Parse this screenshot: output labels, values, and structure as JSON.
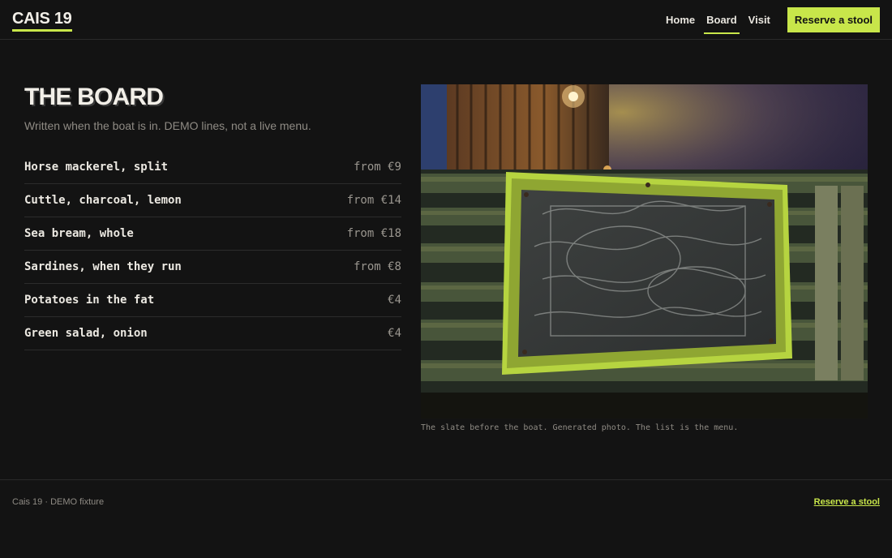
{
  "header": {
    "logo": "CAIS 19",
    "nav": [
      {
        "label": "Home",
        "active": false
      },
      {
        "label": "Board",
        "active": true
      },
      {
        "label": "Visit",
        "active": false
      }
    ],
    "cta_label": "Reserve a stool"
  },
  "board": {
    "title": "THE BOARD",
    "subtitle": "Written when the boat is in. DEMO lines, not a live menu.",
    "items": [
      {
        "name": "Horse mackerel, split",
        "price": "from €9"
      },
      {
        "name": "Cuttle, charcoal, lemon",
        "price": "from €14"
      },
      {
        "name": "Sea bream, whole",
        "price": "from €18"
      },
      {
        "name": "Sardines, when they run",
        "price": "from €8"
      },
      {
        "name": "Potatoes in the fat",
        "price": "€4"
      },
      {
        "name": "Green salad, onion",
        "price": "€4"
      }
    ]
  },
  "photo": {
    "caption": "The slate before the boat. Generated photo. The list is the menu."
  },
  "footer": {
    "text": "Cais 19 · DEMO fixture",
    "link_label": "Reserve a stool"
  },
  "colors": {
    "accent": "#c8e64a",
    "background": "#131313"
  }
}
